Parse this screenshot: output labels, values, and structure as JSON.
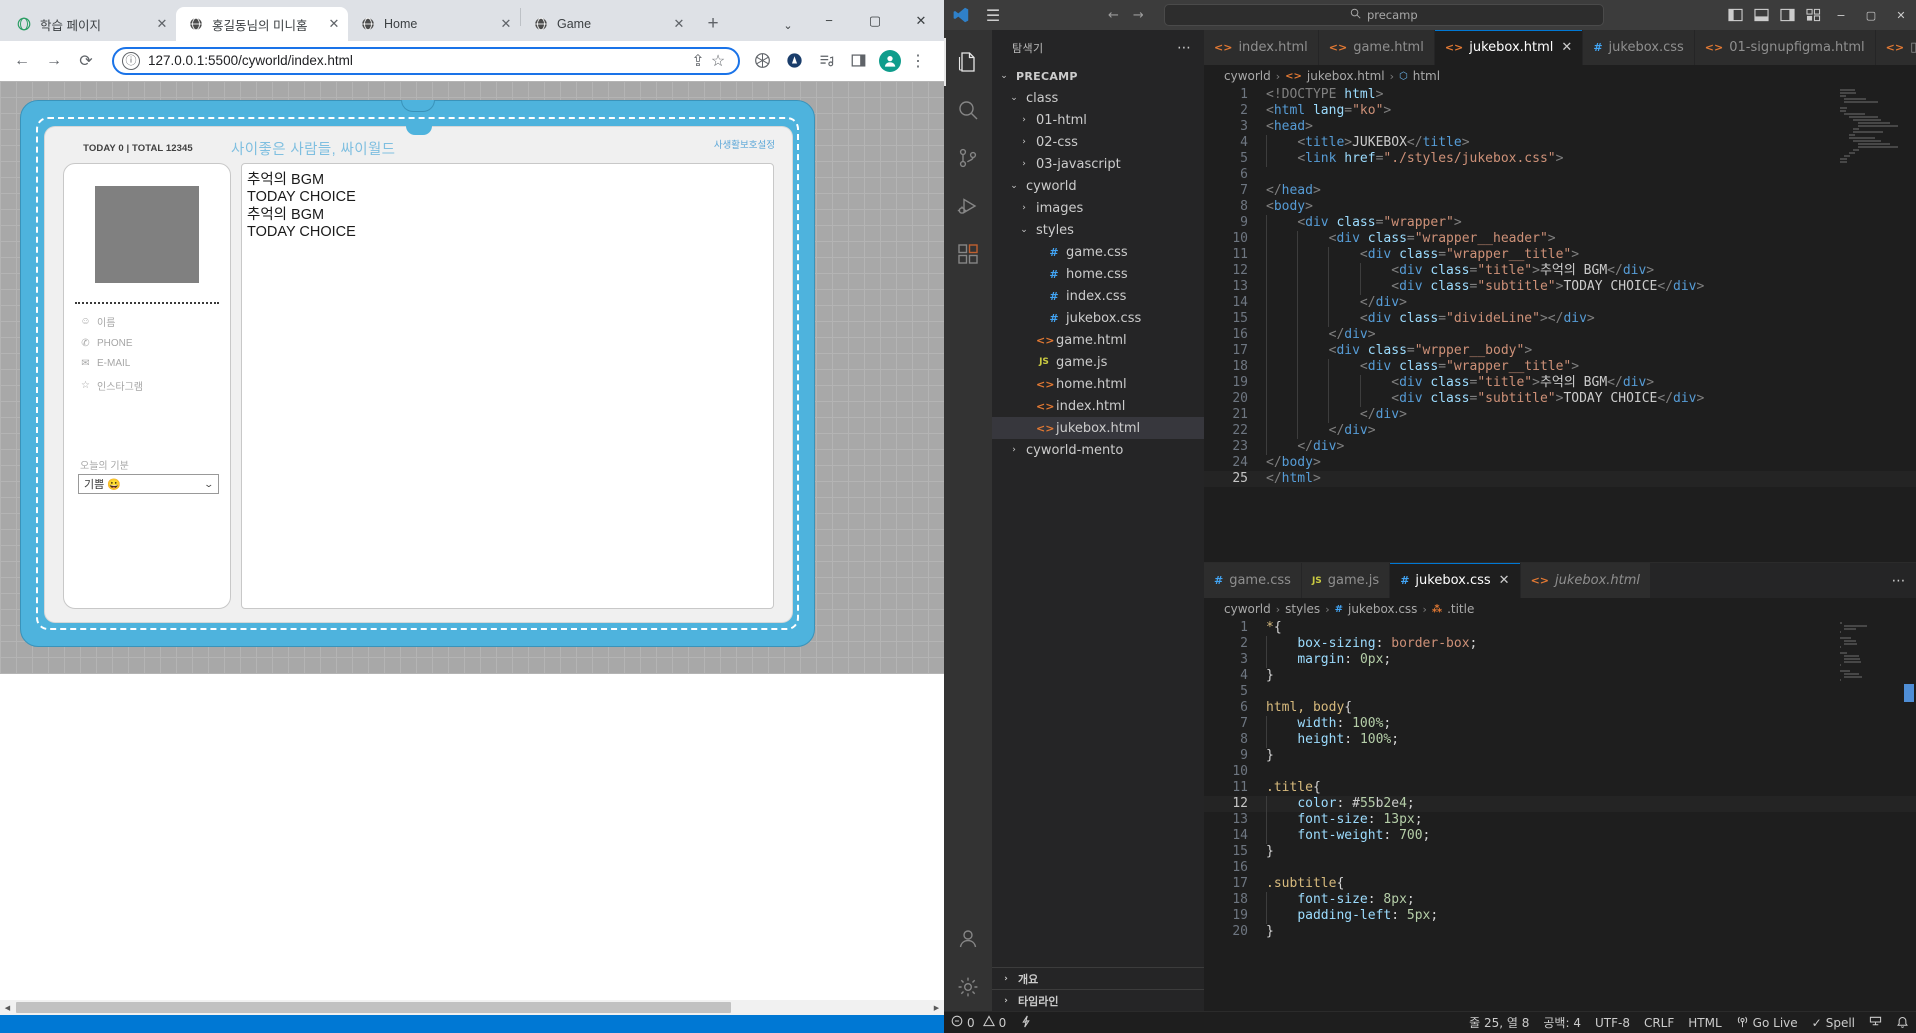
{
  "browser": {
    "tabs": [
      {
        "title": "학습 페이지",
        "favicon": "globe-icon",
        "active": false,
        "close": "✕"
      },
      {
        "title": "홍길동님의 미니홈",
        "favicon": "globe-icon",
        "active": true,
        "close": "✕"
      },
      {
        "title": "Home",
        "favicon": "globe-icon",
        "active": false,
        "close": "✕"
      },
      {
        "title": "Game",
        "favicon": "globe-icon",
        "active": false,
        "close": "✕"
      }
    ],
    "newtab_label": "+",
    "tabstrip_chevron": "⌄",
    "window_buttons": {
      "minimize": "−",
      "maximize": "▢",
      "close": "✕"
    },
    "toolbar": {
      "back": "←",
      "forward": "→",
      "reload": "⟳",
      "info_icon": "ⓘ",
      "url": "127.0.0.1:5500/cyworld/index.html",
      "share": "⇪",
      "bookmark": "☆",
      "extensions": "✷",
      "profile_pic": "▲",
      "avatar": "avatar-icon",
      "menu": "⋮"
    }
  },
  "cyworld": {
    "visits": "TODAY 0 | TOTAL 12345",
    "slogan": "사이좋은 사람들, 싸이월드",
    "privacy_link": "사생활보호설정",
    "profile": {
      "photo_alt": "profile-photo",
      "meta": [
        {
          "icon": "☺",
          "label": "이름"
        },
        {
          "icon": "✆",
          "label": "PHONE"
        },
        {
          "icon": "✉",
          "label": "E-MAIL"
        },
        {
          "icon": "☆",
          "label": "인스타그램"
        }
      ],
      "mood_label": "오늘의 기분",
      "mood_value": "기쁨 😀",
      "mood_caret": "⌄"
    },
    "content_lines": [
      "추억의 BGM",
      "TODAY CHOICE",
      "추억의 BGM",
      "TODAY CHOICE"
    ],
    "scrollbar": {
      "left_arrow": "◀",
      "right_arrow": "▶"
    }
  },
  "vscode": {
    "titlebar": {
      "hamburger": "☰",
      "back": "←",
      "forward": "→",
      "search_icon": "search-icon",
      "search_text": "precamp",
      "layout_icons": [
        "toggle-primary-sidebar",
        "toggle-panel",
        "toggle-secondary-sidebar",
        "customize-layout"
      ],
      "window_buttons": {
        "minimize": "−",
        "maximize": "▢",
        "close": "✕"
      }
    },
    "activitybar": [
      {
        "name": "explorer-icon",
        "active": true
      },
      {
        "name": "search-icon",
        "active": false
      },
      {
        "name": "source-control-icon",
        "active": false
      },
      {
        "name": "run-and-debug-icon",
        "active": false
      },
      {
        "name": "extensions-icon",
        "active": false
      },
      {
        "name": "accounts-icon",
        "active": false
      },
      {
        "name": "settings-gear-icon",
        "active": false
      }
    ],
    "sidebar": {
      "header": "탐색기",
      "header_dots": "⋯",
      "tree": [
        {
          "label": "PRECAMP",
          "depth": 0,
          "chev": "⌄",
          "icon": "",
          "kind": "root",
          "selected": false
        },
        {
          "label": "class",
          "depth": 1,
          "chev": "⌄",
          "icon": "",
          "kind": "folder",
          "selected": false
        },
        {
          "label": "01-html",
          "depth": 2,
          "chev": "›",
          "icon": "",
          "kind": "folder",
          "selected": false
        },
        {
          "label": "02-css",
          "depth": 2,
          "chev": "›",
          "icon": "",
          "kind": "folder",
          "selected": false
        },
        {
          "label": "03-javascript",
          "depth": 2,
          "chev": "›",
          "icon": "",
          "kind": "folder",
          "selected": false
        },
        {
          "label": "cyworld",
          "depth": 1,
          "chev": "⌄",
          "icon": "",
          "kind": "folder",
          "selected": false
        },
        {
          "label": "images",
          "depth": 2,
          "chev": "›",
          "icon": "",
          "kind": "folder",
          "selected": false
        },
        {
          "label": "styles",
          "depth": 2,
          "chev": "⌄",
          "icon": "",
          "kind": "folder",
          "selected": false
        },
        {
          "label": "game.css",
          "depth": 3,
          "chev": "",
          "icon": "#",
          "kind": "css",
          "selected": false
        },
        {
          "label": "home.css",
          "depth": 3,
          "chev": "",
          "icon": "#",
          "kind": "css",
          "selected": false
        },
        {
          "label": "index.css",
          "depth": 3,
          "chev": "",
          "icon": "#",
          "kind": "css",
          "selected": false
        },
        {
          "label": "jukebox.css",
          "depth": 3,
          "chev": "",
          "icon": "#",
          "kind": "css",
          "selected": false
        },
        {
          "label": "game.html",
          "depth": 2,
          "chev": "",
          "icon": "<>",
          "kind": "html",
          "selected": false
        },
        {
          "label": "game.js",
          "depth": 2,
          "chev": "",
          "icon": "JS",
          "kind": "js",
          "selected": false
        },
        {
          "label": "home.html",
          "depth": 2,
          "chev": "",
          "icon": "<>",
          "kind": "html",
          "selected": false
        },
        {
          "label": "index.html",
          "depth": 2,
          "chev": "",
          "icon": "<>",
          "kind": "html",
          "selected": false
        },
        {
          "label": "jukebox.html",
          "depth": 2,
          "chev": "",
          "icon": "<>",
          "kind": "html",
          "selected": true
        },
        {
          "label": "cyworld-mento",
          "depth": 1,
          "chev": "›",
          "icon": "",
          "kind": "folder",
          "selected": false
        }
      ],
      "sections": [
        {
          "label": "개요",
          "chev": "›"
        },
        {
          "label": "타임라인",
          "chev": "›"
        }
      ]
    },
    "editor_top": {
      "tabs": [
        {
          "label": "index.html",
          "icon": "<>",
          "kind": "html",
          "active": false,
          "dirty": false
        },
        {
          "label": "game.html",
          "icon": "<>",
          "kind": "html",
          "active": false,
          "dirty": false
        },
        {
          "label": "jukebox.html",
          "icon": "<>",
          "kind": "html",
          "active": true,
          "close": "✕"
        },
        {
          "label": "jukebox.css",
          "icon": "#",
          "kind": "css",
          "active": false,
          "dirty": false
        },
        {
          "label": "01-signupfigma.html",
          "icon": "<>",
          "kind": "html",
          "active": false,
          "dirty": false
        }
      ],
      "overflow_tab_icon": "split-editor-icon",
      "tabbar_dots": "⋯",
      "breadcrumb": [
        "cyworld",
        "jukebox.html",
        "html"
      ],
      "breadcrumb_icons": [
        "",
        "<>",
        "⬡"
      ],
      "lines": [
        {
          "n": 1,
          "indent": 0,
          "cur": false
        },
        {
          "n": 2,
          "indent": 0,
          "cur": false
        },
        {
          "n": 3,
          "indent": 0,
          "cur": false
        },
        {
          "n": 4,
          "indent": 1,
          "cur": false
        },
        {
          "n": 5,
          "indent": 1,
          "cur": false
        },
        {
          "n": 6,
          "indent": 1,
          "cur": false
        },
        {
          "n": 7,
          "indent": 0,
          "cur": false
        },
        {
          "n": 8,
          "indent": 0,
          "cur": false
        },
        {
          "n": 9,
          "indent": 1,
          "cur": false
        },
        {
          "n": 10,
          "indent": 2,
          "cur": false
        },
        {
          "n": 11,
          "indent": 3,
          "cur": false
        },
        {
          "n": 12,
          "indent": 4,
          "cur": false
        },
        {
          "n": 13,
          "indent": 4,
          "cur": false
        },
        {
          "n": 14,
          "indent": 3,
          "cur": false
        },
        {
          "n": 15,
          "indent": 3,
          "cur": false
        },
        {
          "n": 16,
          "indent": 2,
          "cur": false
        },
        {
          "n": 17,
          "indent": 2,
          "cur": false
        },
        {
          "n": 18,
          "indent": 3,
          "cur": false
        },
        {
          "n": 19,
          "indent": 4,
          "cur": false
        },
        {
          "n": 20,
          "indent": 4,
          "cur": false
        },
        {
          "n": 21,
          "indent": 3,
          "cur": false
        },
        {
          "n": 22,
          "indent": 2,
          "cur": false
        },
        {
          "n": 23,
          "indent": 1,
          "cur": false
        },
        {
          "n": 24,
          "indent": 0,
          "cur": false
        },
        {
          "n": 25,
          "indent": 0,
          "cur": true
        }
      ],
      "code_text": [
        "<!DOCTYPE html>",
        "<html lang=\"ko\">",
        "<head>",
        "    <title>JUKEBOX</title>",
        "    <link href=\"./styles/jukebox.css\">",
        "",
        "</head>",
        "<body>",
        "    <div class=\"wrapper\">",
        "        <div class=\"wrapper__header\">",
        "            <div class=\"wrapper__title\">",
        "                <div class=\"title\">추억의 BGM</div>",
        "                <div class=\"subtitle\">TODAY CHOICE</div>",
        "            </div>",
        "            <div class=\"divideLine\"></div>",
        "        </div>",
        "        <div class=\"wrpper__body\">",
        "            <div class=\"wrapper__title\">",
        "                <div class=\"title\">추억의 BGM</div>",
        "                <div class=\"subtitle\">TODAY CHOICE</div>",
        "            </div>",
        "        </div>",
        "    </div>",
        "</body>",
        "</html>"
      ]
    },
    "editor_bottom": {
      "tabs": [
        {
          "label": "game.css",
          "icon": "#",
          "kind": "css",
          "active": false
        },
        {
          "label": "game.js",
          "icon": "JS",
          "kind": "js",
          "active": false
        },
        {
          "label": "jukebox.css",
          "icon": "#",
          "kind": "css",
          "active": true,
          "close": "✕"
        },
        {
          "label": "jukebox.html",
          "icon": "<>",
          "kind": "html",
          "active": false,
          "preview": true
        }
      ],
      "tabbar_dots": "⋯",
      "breadcrumb": [
        "cyworld",
        "styles",
        "jukebox.css",
        ".title"
      ],
      "code_text": [
        "*{",
        "    box-sizing: border-box;",
        "    margin: 0px;",
        "}",
        "",
        "html, body{",
        "    width: 100%;",
        "    height: 100%;",
        "}",
        "",
        ".title{",
        "    color: #55b2e4;",
        "    font-size: 13px;",
        "    font-weight: 700;",
        "}",
        "",
        ".subtitle{",
        "    font-size: 8px;",
        "    padding-left: 5px;",
        "}"
      ],
      "selected_color": "#55b2e4",
      "cursor_line": 12
    },
    "statusbar": {
      "errors_icon": "error-icon",
      "errors": "0",
      "warnings_icon": "warning-icon",
      "warnings": "0",
      "ports_icon": "ports-icon",
      "cursor": "줄 25, 열 8",
      "spaces": "공백: 4",
      "encoding": "UTF-8",
      "eol": "CRLF",
      "language": "HTML",
      "golive_icon": "broadcast-icon",
      "golive": "Go Live",
      "spell_check": "Spell",
      "spell_icon": "✓",
      "remote_icon": "remote-icon",
      "bell_icon": "bell-icon"
    }
  }
}
